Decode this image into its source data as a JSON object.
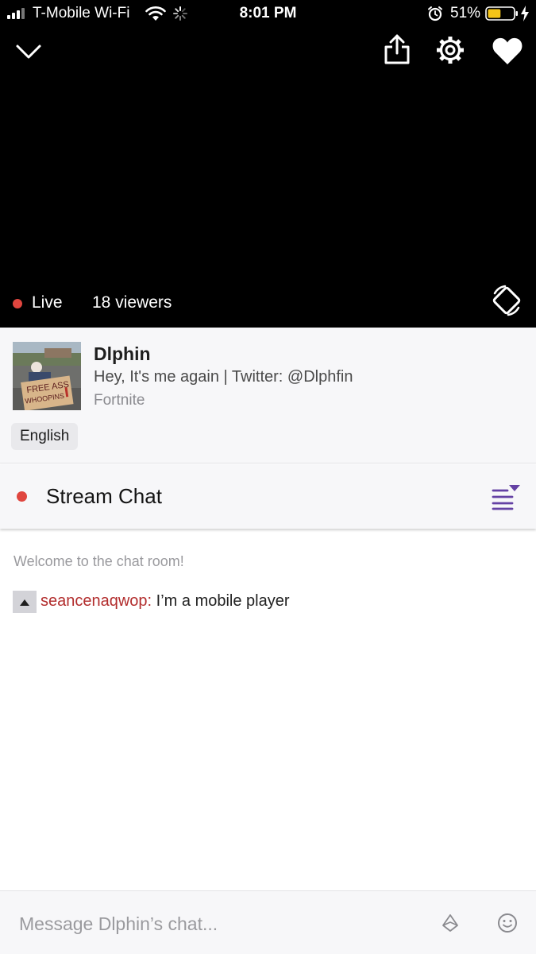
{
  "status_bar": {
    "carrier": "T-Mobile Wi-Fi",
    "time": "8:01 PM",
    "battery_percent": "51%",
    "battery_level": 0.51,
    "icons": [
      "signal-icon",
      "wifi-icon",
      "activity-spinner-icon",
      "alarm-icon",
      "battery-icon",
      "charging-bolt-icon"
    ]
  },
  "player": {
    "top_icons": [
      "chevron-down-icon",
      "share-icon",
      "gear-icon",
      "heart-icon"
    ],
    "live_label": "Live",
    "viewers": "18 viewers",
    "rotate_icon": "rotate-icon",
    "live_color": "#e0463f"
  },
  "stream_info": {
    "channel_name": "Dlphin",
    "title": "Hey, It's me again | Twitter: @Dlphfin",
    "game": "Fortnite",
    "language_tag": "English",
    "thumbnail_sign_text": "FREE ASS WHOOPINS"
  },
  "chat": {
    "header_title": "Stream Chat",
    "options_icon": "chat-filter-icon",
    "welcome": "Welcome to the chat room!",
    "messages": [
      {
        "user": "seancenaqwop:",
        "text": "I’m a mobile player",
        "username_color": "#b22d2d",
        "badge_icon": "triangle-badge-icon"
      }
    ]
  },
  "composer": {
    "placeholder": "Message Dlphin’s chat...",
    "icons": [
      "bits-icon",
      "emote-icon"
    ]
  },
  "colors": {
    "accent": "#6441a4",
    "video_bg": "#000000",
    "panel_bg": "#f7f7f9"
  }
}
